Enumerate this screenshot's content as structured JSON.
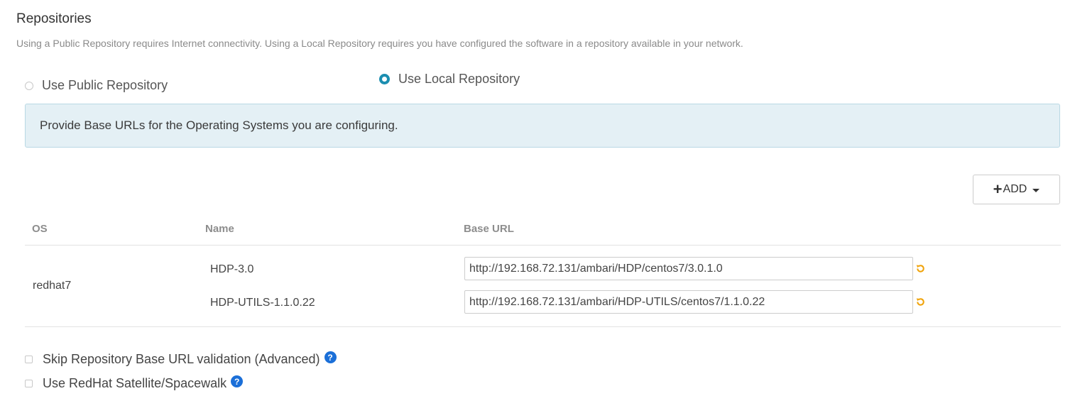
{
  "header": {
    "title": "Repositories",
    "description": "Using a Public Repository requires Internet connectivity. Using a Local Repository requires you have configured the software in a repository available in your network."
  },
  "repo_choice": {
    "public_label": "Use Public Repository",
    "public_selected": false,
    "local_label": "Use Local Repository",
    "local_selected": true
  },
  "info": {
    "message": "Provide Base URLs for the Operating Systems you are configuring."
  },
  "toolbar": {
    "add_label": "ADD"
  },
  "table": {
    "headers": {
      "os": "OS",
      "name": "Name",
      "base_url": "Base URL"
    },
    "rows": [
      {
        "os": "redhat7",
        "repos": [
          {
            "name": "HDP-3.0",
            "base_url": "http://192.168.72.131/ambari/HDP/centos7/3.0.1.0"
          },
          {
            "name": "HDP-UTILS-1.1.0.22",
            "base_url": "http://192.168.72.131/ambari/HDP-UTILS/centos7/1.1.0.22"
          }
        ]
      }
    ]
  },
  "options": {
    "skip_validation_label": "Skip Repository Base URL validation (Advanced)",
    "skip_validation_checked": false,
    "satellite_label": "Use RedHat Satellite/Spacewalk",
    "satellite_checked": false
  },
  "icons": {
    "undo": "undo-icon",
    "help": "question-circle-icon",
    "plus": "plus-icon",
    "caret": "caret-down-icon"
  },
  "colors": {
    "accent": "#1b8eb0",
    "info_bg": "#e4f0f5",
    "undo_orange": "#f0a30a",
    "help_blue": "#1b6fd8"
  }
}
